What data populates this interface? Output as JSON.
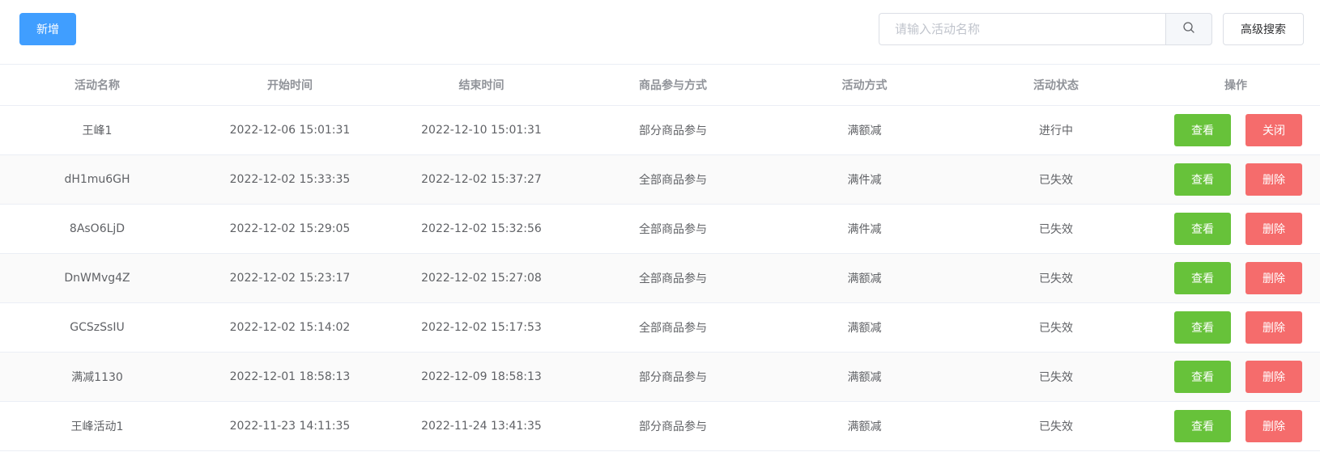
{
  "toolbar": {
    "add_label": "新增",
    "search_placeholder": "请输入活动名称",
    "search_value": "",
    "advanced_search_label": "高级搜索",
    "primary_color": "#409eff"
  },
  "table": {
    "columns": [
      "活动名称",
      "开始时间",
      "结束时间",
      "商品参与方式",
      "活动方式",
      "活动状态",
      "操作"
    ],
    "rows": [
      {
        "name": "王峰1",
        "start": "2022-12-06 15:01:31",
        "end": "2022-12-10 15:01:31",
        "participation": "部分商品参与",
        "method": "满额减",
        "status": "进行中",
        "view_label": "查看",
        "action_label": "关闭"
      },
      {
        "name": "dH1mu6GH",
        "start": "2022-12-02 15:33:35",
        "end": "2022-12-02 15:37:27",
        "participation": "全部商品参与",
        "method": "满件减",
        "status": "已失效",
        "view_label": "查看",
        "action_label": "删除"
      },
      {
        "name": "8AsO6LjD",
        "start": "2022-12-02 15:29:05",
        "end": "2022-12-02 15:32:56",
        "participation": "全部商品参与",
        "method": "满件减",
        "status": "已失效",
        "view_label": "查看",
        "action_label": "删除"
      },
      {
        "name": "DnWMvg4Z",
        "start": "2022-12-02 15:23:17",
        "end": "2022-12-02 15:27:08",
        "participation": "全部商品参与",
        "method": "满额减",
        "status": "已失效",
        "view_label": "查看",
        "action_label": "删除"
      },
      {
        "name": "GCSzSsIU",
        "start": "2022-12-02 15:14:02",
        "end": "2022-12-02 15:17:53",
        "participation": "全部商品参与",
        "method": "满额减",
        "status": "已失效",
        "view_label": "查看",
        "action_label": "删除"
      },
      {
        "name": "满减1130",
        "start": "2022-12-01 18:58:13",
        "end": "2022-12-09 18:58:13",
        "participation": "部分商品参与",
        "method": "满额减",
        "status": "已失效",
        "view_label": "查看",
        "action_label": "删除"
      },
      {
        "name": "王峰活动1",
        "start": "2022-11-23 14:11:35",
        "end": "2022-11-24 13:41:35",
        "participation": "部分商品参与",
        "method": "满额减",
        "status": "已失效",
        "view_label": "查看",
        "action_label": "删除"
      }
    ]
  },
  "colors": {
    "view": "#67c23a",
    "danger": "#f56c6c",
    "header_text": "#909399",
    "cell_text": "#606266",
    "border": "#ebeef5"
  },
  "icons": {
    "search": "search-icon"
  }
}
